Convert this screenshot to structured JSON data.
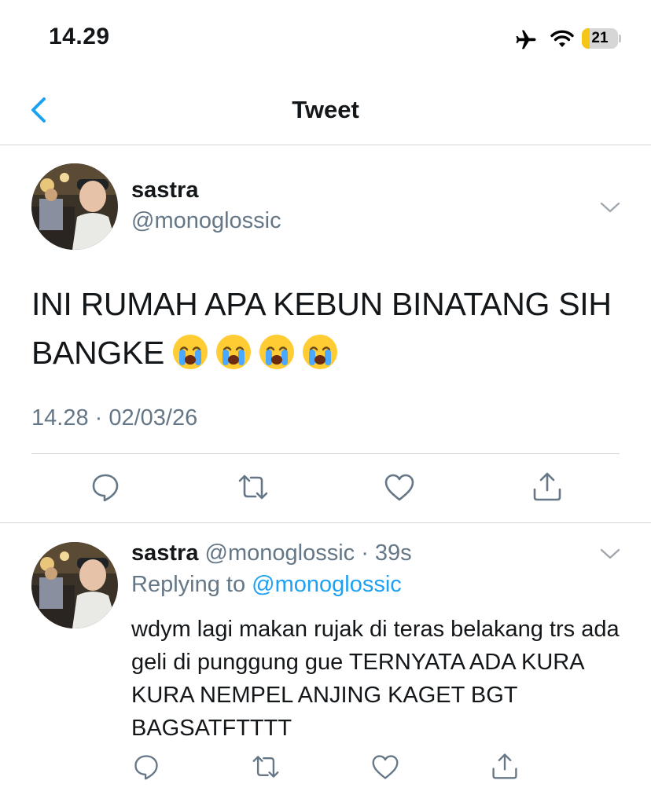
{
  "status_bar": {
    "time": "14.29",
    "battery_level": "21",
    "battery_fraction": 0.21,
    "icons": [
      "airplane-icon",
      "wifi-icon",
      "battery-icon"
    ]
  },
  "nav": {
    "title": "Tweet",
    "back_icon": "chevron-left-icon"
  },
  "tweet": {
    "name": "sastra",
    "handle": "@monoglossic",
    "text": "INI RUMAH APA KEBUN BINATANG SIH BANGKE",
    "emojis": [
      "loudly-crying-face",
      "loudly-crying-face",
      "loudly-crying-face",
      "loudly-crying-face"
    ],
    "timestamp": "14.28 · 02/03/26",
    "actions": [
      "reply-icon",
      "retweet-icon",
      "like-icon",
      "share-icon"
    ]
  },
  "reply": {
    "name": "sastra",
    "handle_time": "@monoglossic · 39s",
    "replying_prefix": "Replying to",
    "replying_to": "@monoglossic",
    "text": "wdym lagi makan rujak di teras belakang trs ada geli di punggung gue TERNYATA ADA KURA KURA NEMPEL ANJING KAGET BGT BAGSATFTTTT",
    "actions": [
      "reply-icon",
      "retweet-icon",
      "like-icon",
      "share-icon"
    ]
  },
  "colors": {
    "accent": "#1da1f2",
    "secondary_text": "#657786",
    "primary_text": "#14171a",
    "divider": "#d6d6d8",
    "battery": "#f5c518"
  }
}
